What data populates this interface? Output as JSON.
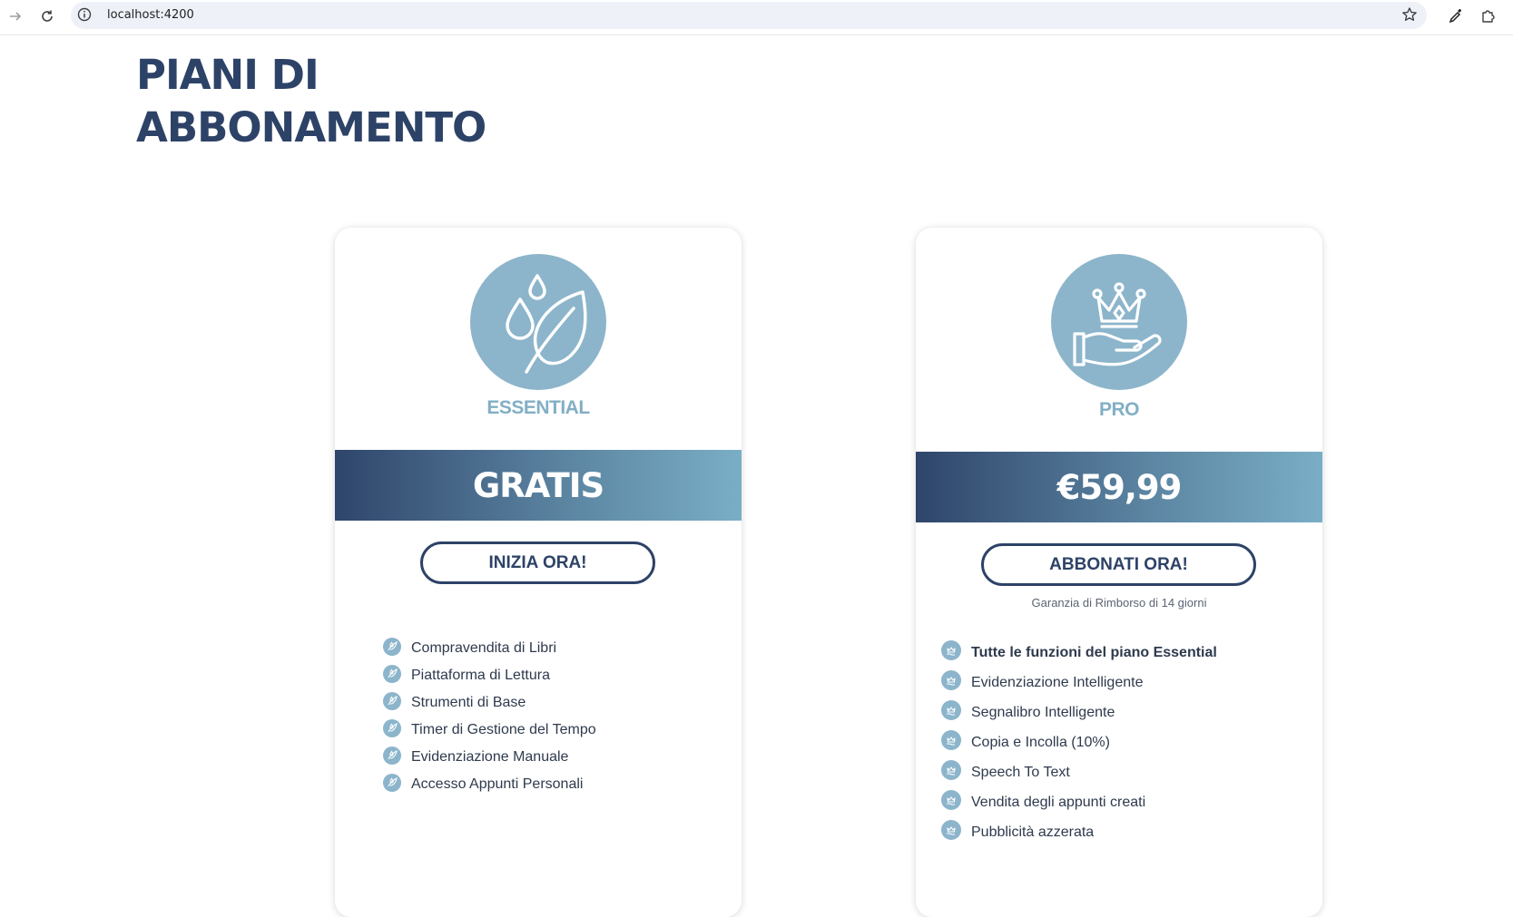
{
  "browser": {
    "url": "localhost:4200"
  },
  "page": {
    "title_line1": "PIANI DI",
    "title_line2": "ABBONAMENTO"
  },
  "plans": [
    {
      "name": "ESSENTIAL",
      "icon": "leaf-drop-icon",
      "price": "GRATIS",
      "cta_label": "INIZIA ORA!",
      "features": [
        "Compravendita di Libri",
        "Piattaforma di Lettura",
        "Strumenti di Base",
        "Timer di Gestione del Tempo",
        "Evidenziazione Manuale",
        "Accesso Appunti Personali"
      ]
    },
    {
      "name": "PRO",
      "icon": "crown-hand-icon",
      "price": "€59,99",
      "cta_label": "ABBONATI ORA!",
      "guarantee": "Garanzia di Rimborso di 14 giorni",
      "features": [
        "Tutte le funzioni del piano Essential",
        "Evidenziazione Intelligente",
        "Segnalibro Intelligente",
        "Copia e Incolla (10%)",
        "Speech To Text",
        "Vendita degli appunti creati",
        "Pubblicità azzerata"
      ]
    }
  ],
  "colors": {
    "title": "#2d4267",
    "accent": "#8cb5cb",
    "band_start": "#2f456b",
    "band_end": "#7aaec6"
  }
}
